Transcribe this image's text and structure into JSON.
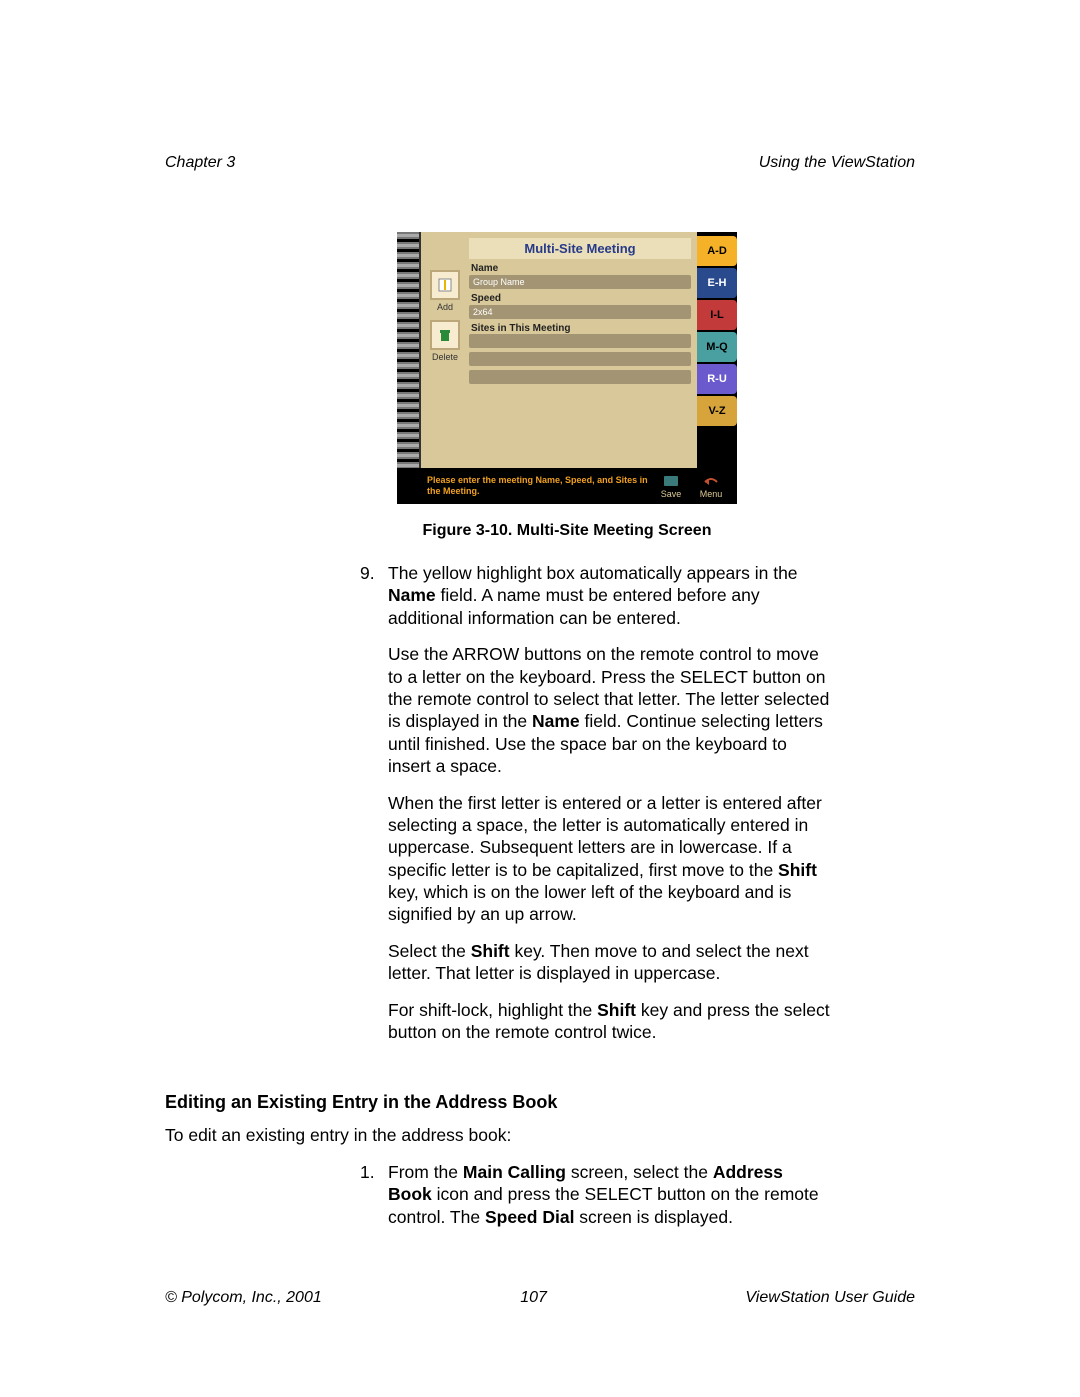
{
  "header": {
    "chapter": "Chapter 3",
    "section": "Using the ViewStation"
  },
  "screenshot": {
    "title": "Multi-Site Meeting",
    "leftButtons": {
      "add": "Add",
      "delete": "Delete"
    },
    "labels": {
      "name": "Name",
      "speed": "Speed",
      "sites": "Sites in This Meeting"
    },
    "fields": {
      "groupName": "Group Name",
      "speedValue": "2x64"
    },
    "tabs": [
      {
        "label": "A-D",
        "color": "#f5b128"
      },
      {
        "label": "E-H",
        "color": "#2a4a8e"
      },
      {
        "label": "I-L",
        "color": "#c33a3a"
      },
      {
        "label": "M-Q",
        "color": "#4aa0a0"
      },
      {
        "label": "R-U",
        "color": "#6a5acd"
      },
      {
        "label": "V-Z",
        "color": "#d6a43a"
      }
    ],
    "prompt": "Please enter the meeting Name, Speed, and Sites in the Meeting.",
    "save": "Save",
    "menu": "Menu"
  },
  "caption": "Figure 3-10.  Multi-Site Meeting Screen",
  "step9": {
    "num": "9.",
    "p1a": "The yellow highlight box automatically appears in the ",
    "p1b": "Name",
    "p1c": " field. A name must be entered before any additional information can be entered.",
    "p2a": "Use the ARROW buttons on the remote control to move to a letter on the keyboard. Press the SELECT button on the remote control to select that letter. The letter selected is displayed in the ",
    "p2b": "Name",
    "p2c": " field. Continue selecting letters until finished. Use the space bar on the keyboard to insert a space.",
    "p3a": "When the first letter is entered or a letter is entered after selecting a space, the letter is automatically entered in uppercase. Subsequent letters are in lowercase. If a specific letter is to be capitalized, first move to the ",
    "p3b": "Shift",
    "p3c": " key, which is on the lower left of the keyboard and is signified by an up arrow.",
    "p4a": "Select the ",
    "p4b": "Shift",
    "p4c": " key. Then move to and select the next letter. That letter is displayed in uppercase.",
    "p5a": "For shift-lock, highlight the ",
    "p5b": "Shift",
    "p5c": " key and press the select button on the remote control twice."
  },
  "editSection": {
    "heading": "Editing an Existing Entry in the Address Book",
    "intro": "To edit an existing entry in the address book:",
    "step1": {
      "num": "1.",
      "a": "From the ",
      "b": "Main Calling",
      "c": " screen, select the ",
      "d": "Address Book",
      "e": " icon and press the SELECT button on the remote control. The ",
      "f": "Speed Dial",
      "g": " screen is displayed."
    }
  },
  "footer": {
    "copyright": "© Polycom, Inc., 2001",
    "page": "107",
    "guide": "ViewStation User Guide"
  }
}
